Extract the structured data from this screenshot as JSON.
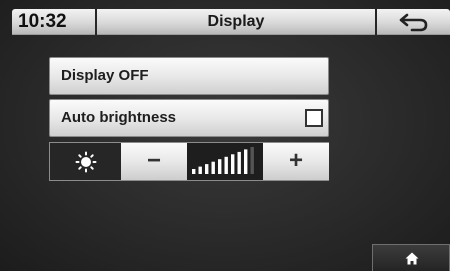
{
  "header": {
    "time": "10:32",
    "title": "Display",
    "back_icon": "back-arrow-icon"
  },
  "menu": {
    "display_off_label": "Display OFF",
    "auto_brightness_label": "Auto brightness",
    "auto_brightness_checked": false
  },
  "brightness": {
    "icon": "sun-icon",
    "decrease_label": "−",
    "increase_label": "+",
    "level_bars_total": 10,
    "level_bars_filled": 9
  },
  "footer": {
    "home_icon": "home-icon"
  }
}
